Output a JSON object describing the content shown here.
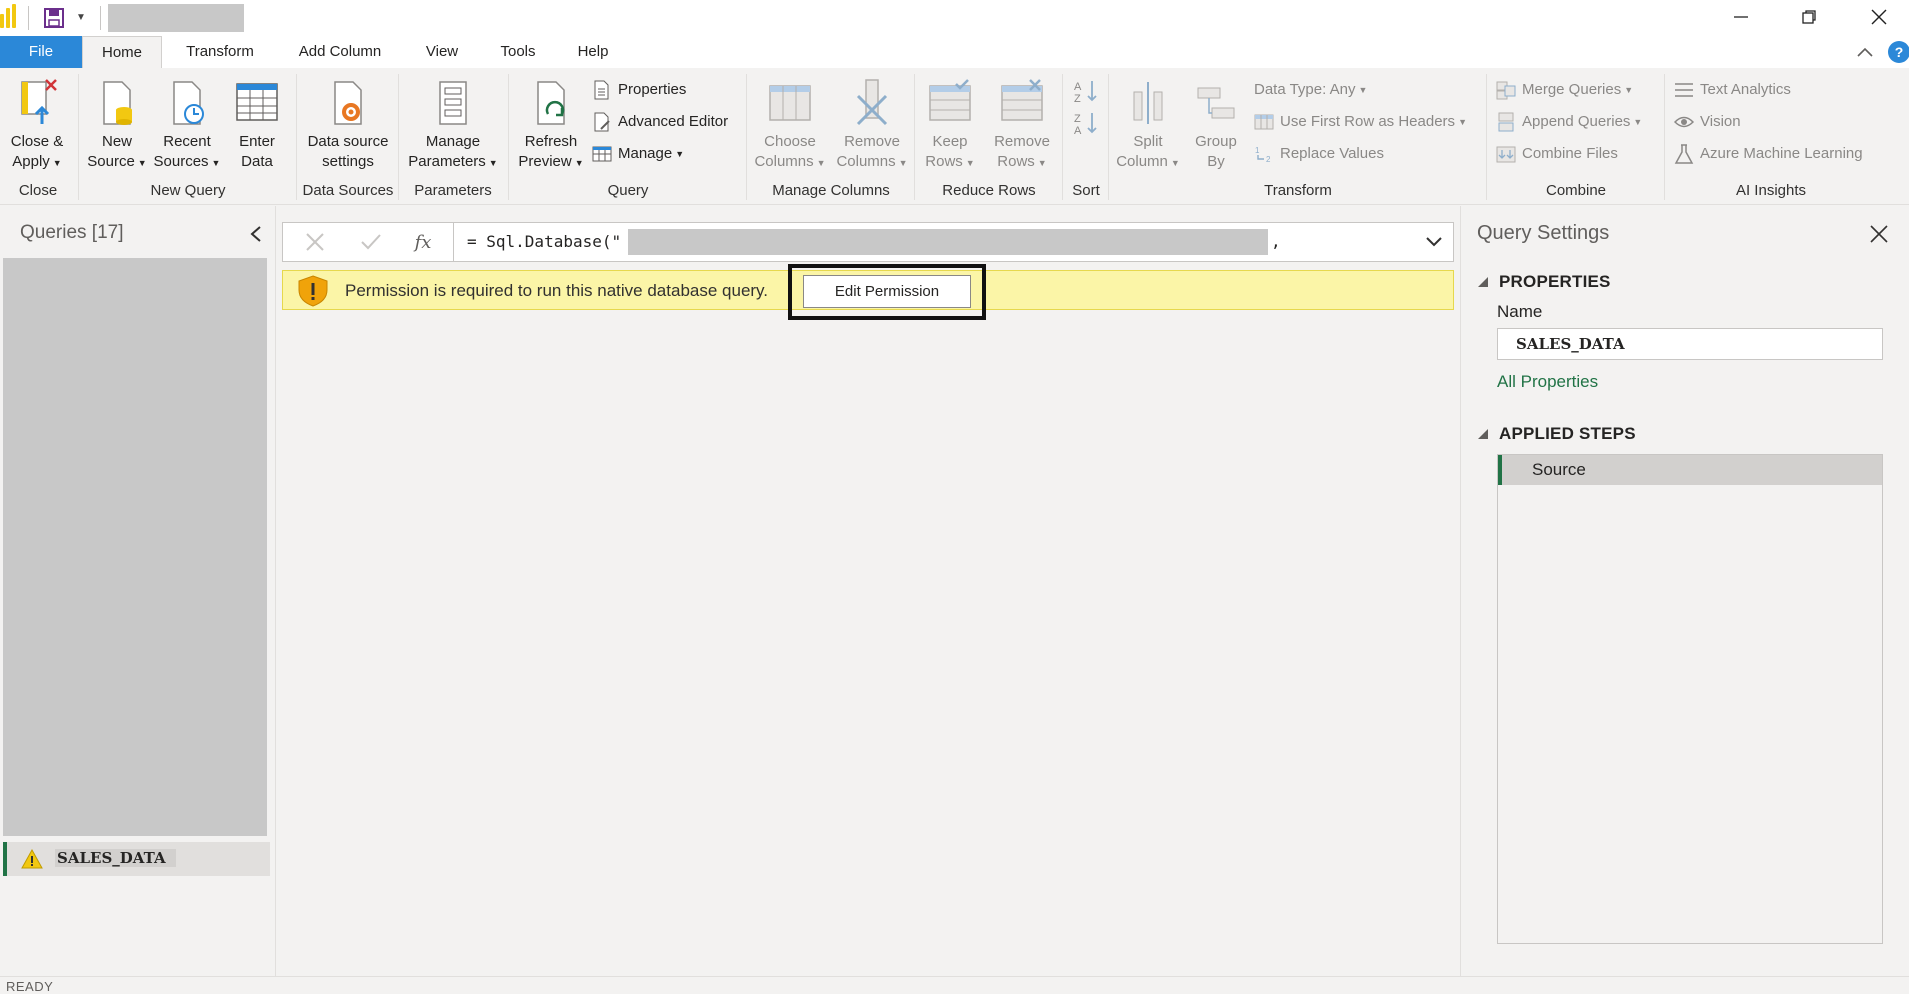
{
  "menu": {
    "tabs": [
      "File",
      "Home",
      "Transform",
      "Add Column",
      "View",
      "Tools",
      "Help"
    ],
    "help_glyph": "?"
  },
  "ribbon": {
    "close": {
      "btn1": "Close &",
      "btn2": "Apply",
      "label": "Close"
    },
    "new_query": {
      "new_source1": "New",
      "new_source2": "Source",
      "recent1": "Recent",
      "recent2": "Sources",
      "enter1": "Enter",
      "enter2": "Data",
      "label": "New Query"
    },
    "data_sources": {
      "btn1": "Data source",
      "btn2": "settings",
      "label": "Data Sources"
    },
    "parameters": {
      "btn1": "Manage",
      "btn2": "Parameters",
      "label": "Parameters"
    },
    "query": {
      "refresh1": "Refresh",
      "refresh2": "Preview",
      "properties": "Properties",
      "advanced_editor": "Advanced Editor",
      "manage": "Manage",
      "label": "Query"
    },
    "manage_columns": {
      "choose1": "Choose",
      "choose2": "Columns",
      "remove1": "Remove",
      "remove2": "Columns",
      "label": "Manage Columns"
    },
    "reduce_rows": {
      "keep1": "Keep",
      "keep2": "Rows",
      "remove1": "Remove",
      "remove2": "Rows",
      "label": "Reduce Rows"
    },
    "sort": {
      "label": "Sort"
    },
    "transform": {
      "split1": "Split",
      "split2": "Column",
      "group1": "Group",
      "group2": "By",
      "data_type": "Data Type: Any",
      "first_row": "Use First Row as Headers",
      "replace": "Replace Values",
      "label": "Transform"
    },
    "combine": {
      "merge": "Merge Queries",
      "append": "Append Queries",
      "files": "Combine Files",
      "label": "Combine"
    },
    "ai": {
      "text": "Text Analytics",
      "vision": "Vision",
      "azure": "Azure Machine Learning",
      "label": "AI Insights"
    }
  },
  "queries_pane": {
    "title": "Queries [17]",
    "selected_query": "SALES_DATA"
  },
  "formula_bar": {
    "text": "= Sql.Database(\"",
    "comma": ",",
    "fx": "fx"
  },
  "banner": {
    "message": "Permission is required to run this native database query.",
    "button": "Edit Permission"
  },
  "settings": {
    "title": "Query Settings",
    "properties": "PROPERTIES",
    "name_label": "Name",
    "name_value": "SALES_DATA",
    "all_properties": "All Properties",
    "applied_steps": "APPLIED STEPS",
    "steps": [
      "Source"
    ]
  },
  "status": {
    "text": "READY"
  },
  "colors": {
    "accent": "#2b88d8",
    "brand_green": "#217346",
    "warning": "#fbf5a7"
  }
}
